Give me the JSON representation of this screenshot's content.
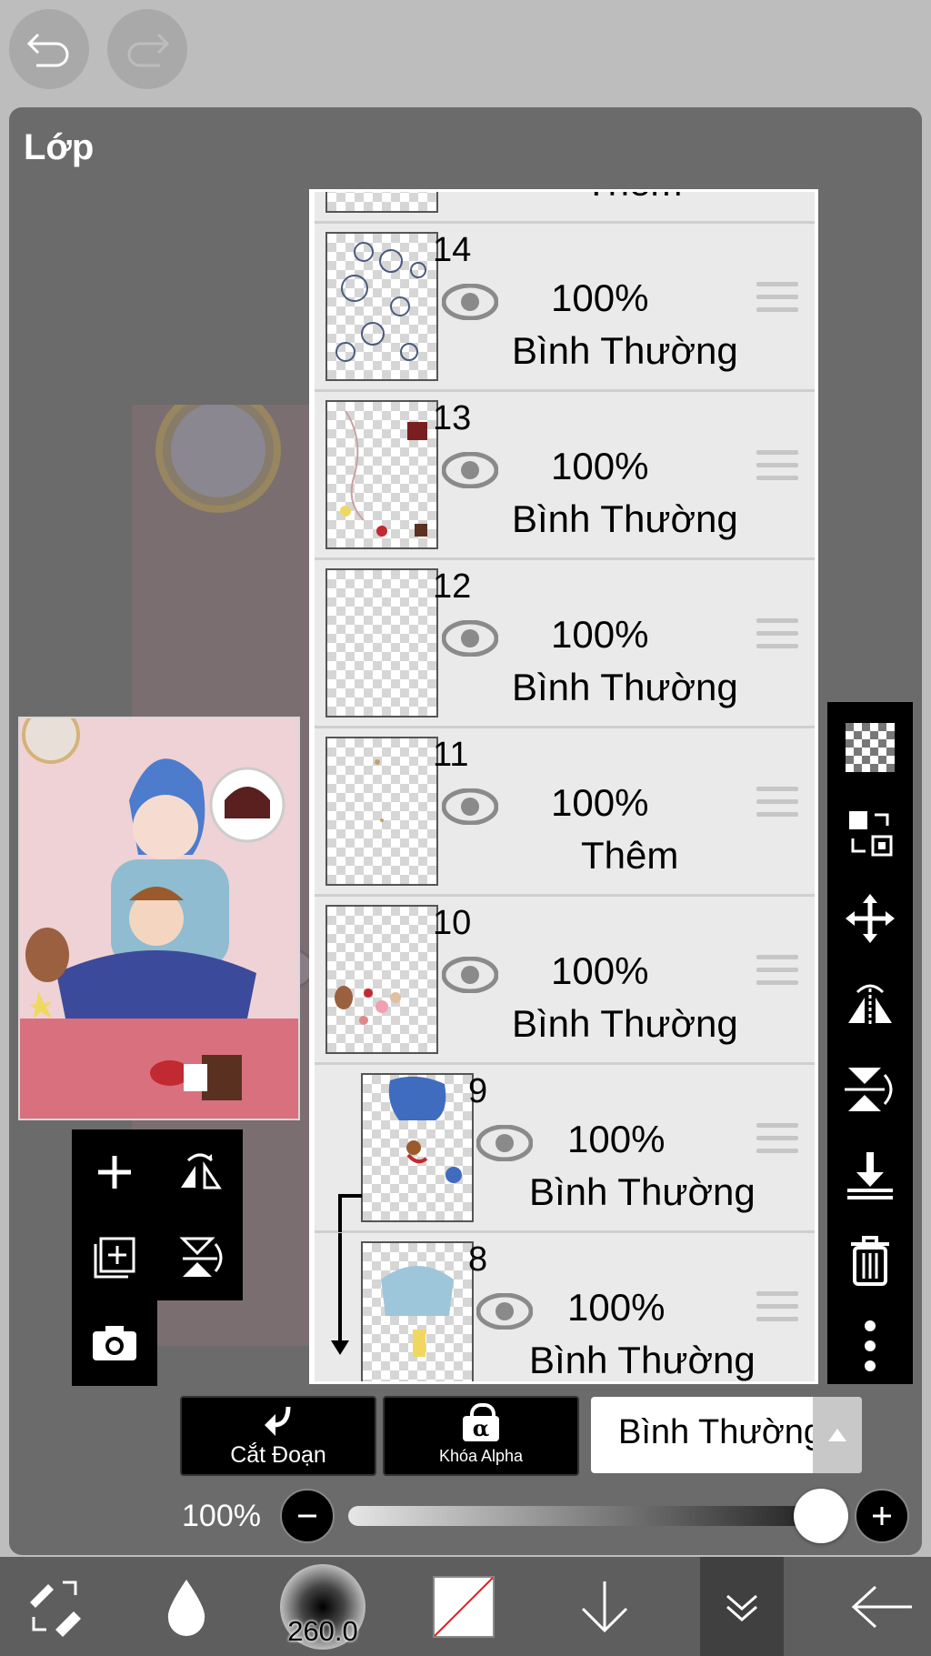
{
  "panel": {
    "title": "Lớp"
  },
  "layers": [
    {
      "number": "14",
      "opacity": "100%",
      "mode": "Bình Thường"
    },
    {
      "number": "13",
      "opacity": "100%",
      "mode": "Bình Thường"
    },
    {
      "number": "12",
      "opacity": "100%",
      "mode": "Bình Thường"
    },
    {
      "number": "11",
      "opacity": "100%",
      "mode": "Thêm"
    },
    {
      "number": "10",
      "opacity": "100%",
      "mode": "Bình Thường"
    },
    {
      "number": "9",
      "opacity": "100%",
      "mode": "Bình Thường"
    },
    {
      "number": "8",
      "opacity": "100%",
      "mode": "Bình Thường"
    }
  ],
  "partial_top_mode": "Thêm",
  "controls": {
    "clip_label": "Cắt Đoạn",
    "alpha_lock_label": "Khóa Alpha",
    "alpha_symbol": "α",
    "blend_mode": "Bình Thường",
    "opacity_label": "100%",
    "opacity_value": 1.0
  },
  "toolbar": {
    "brush_size": "260.0"
  },
  "icons": {
    "undo": "undo-icon",
    "redo": "redo-icon",
    "add_layer": "plus-icon",
    "add_layer_special": "add-layer-icon",
    "camera": "camera-icon",
    "flip_h": "flip-horizontal-icon",
    "flip_v": "flip-vertical-icon",
    "checker": "transparency-icon",
    "transform": "transform-icon",
    "move": "move-icon",
    "merge_down": "merge-down-icon",
    "trash": "trash-icon",
    "more": "more-icon"
  }
}
